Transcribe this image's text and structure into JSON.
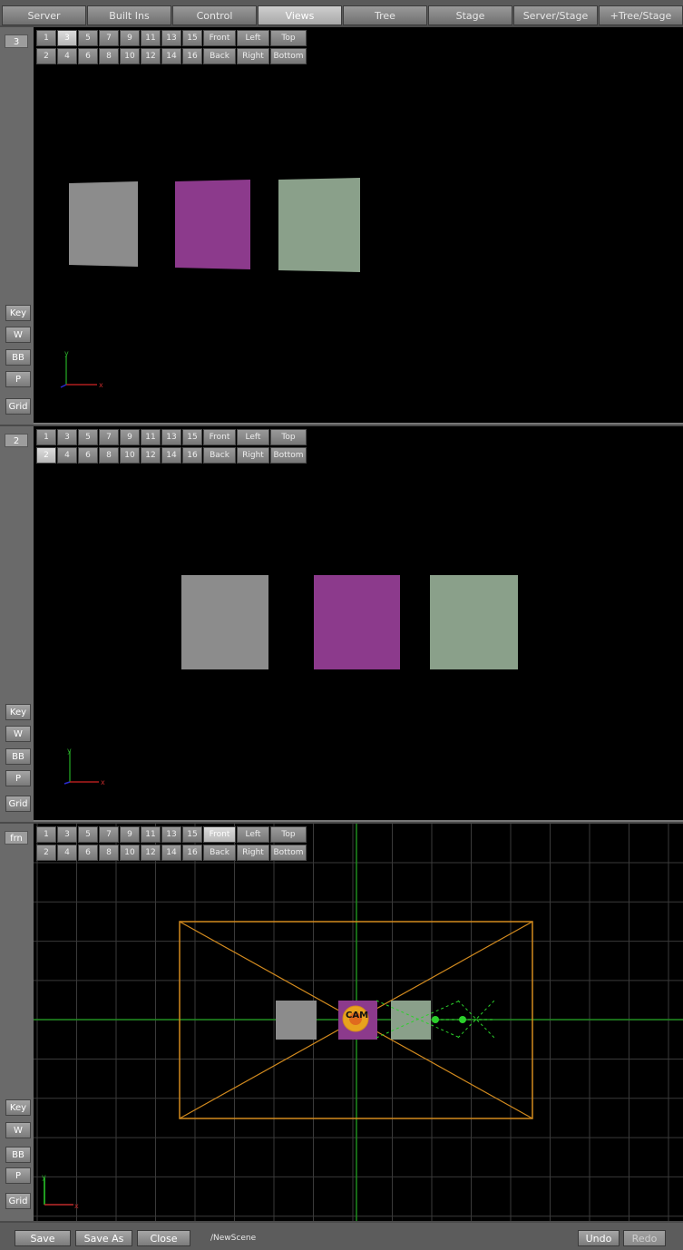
{
  "tabs": [
    {
      "label": "Server",
      "active": false
    },
    {
      "label": "Built Ins",
      "active": false
    },
    {
      "label": "Control",
      "active": false
    },
    {
      "label": "Views",
      "active": true
    },
    {
      "label": "Tree",
      "active": false
    },
    {
      "label": "Stage",
      "active": false
    },
    {
      "label": "Server/Stage",
      "active": false
    },
    {
      "label": "+Tree/Stage",
      "active": false
    }
  ],
  "view_buttons": {
    "row1": [
      "1",
      "3",
      "5",
      "7",
      "9",
      "11",
      "13",
      "15",
      "Front",
      "Left",
      "Top"
    ],
    "row2": [
      "2",
      "4",
      "6",
      "8",
      "10",
      "12",
      "14",
      "16",
      "Back",
      "Right",
      "Bottom"
    ]
  },
  "side_buttons": {
    "key": "Key",
    "w": "W",
    "bb": "BB",
    "p": "P",
    "grid": "Grid"
  },
  "viewports": [
    {
      "label": "3",
      "selected_button": "3"
    },
    {
      "label": "2",
      "selected_button": "2"
    },
    {
      "label": "frn",
      "selected_button": "Front"
    }
  ],
  "axes": {
    "x": "x",
    "y": "y"
  },
  "camera_label": "CAM",
  "object_colors": {
    "gray": "#8c8c8c",
    "purple": "#8c3a8c",
    "green": "#8aa08a",
    "camera_frame": "#d28a1e",
    "axis_green": "#1e8c1e"
  },
  "footer": {
    "save": "Save",
    "save_as": "Save As",
    "close": "Close",
    "path": "/NewScene",
    "undo": "Undo",
    "redo": "Redo"
  }
}
